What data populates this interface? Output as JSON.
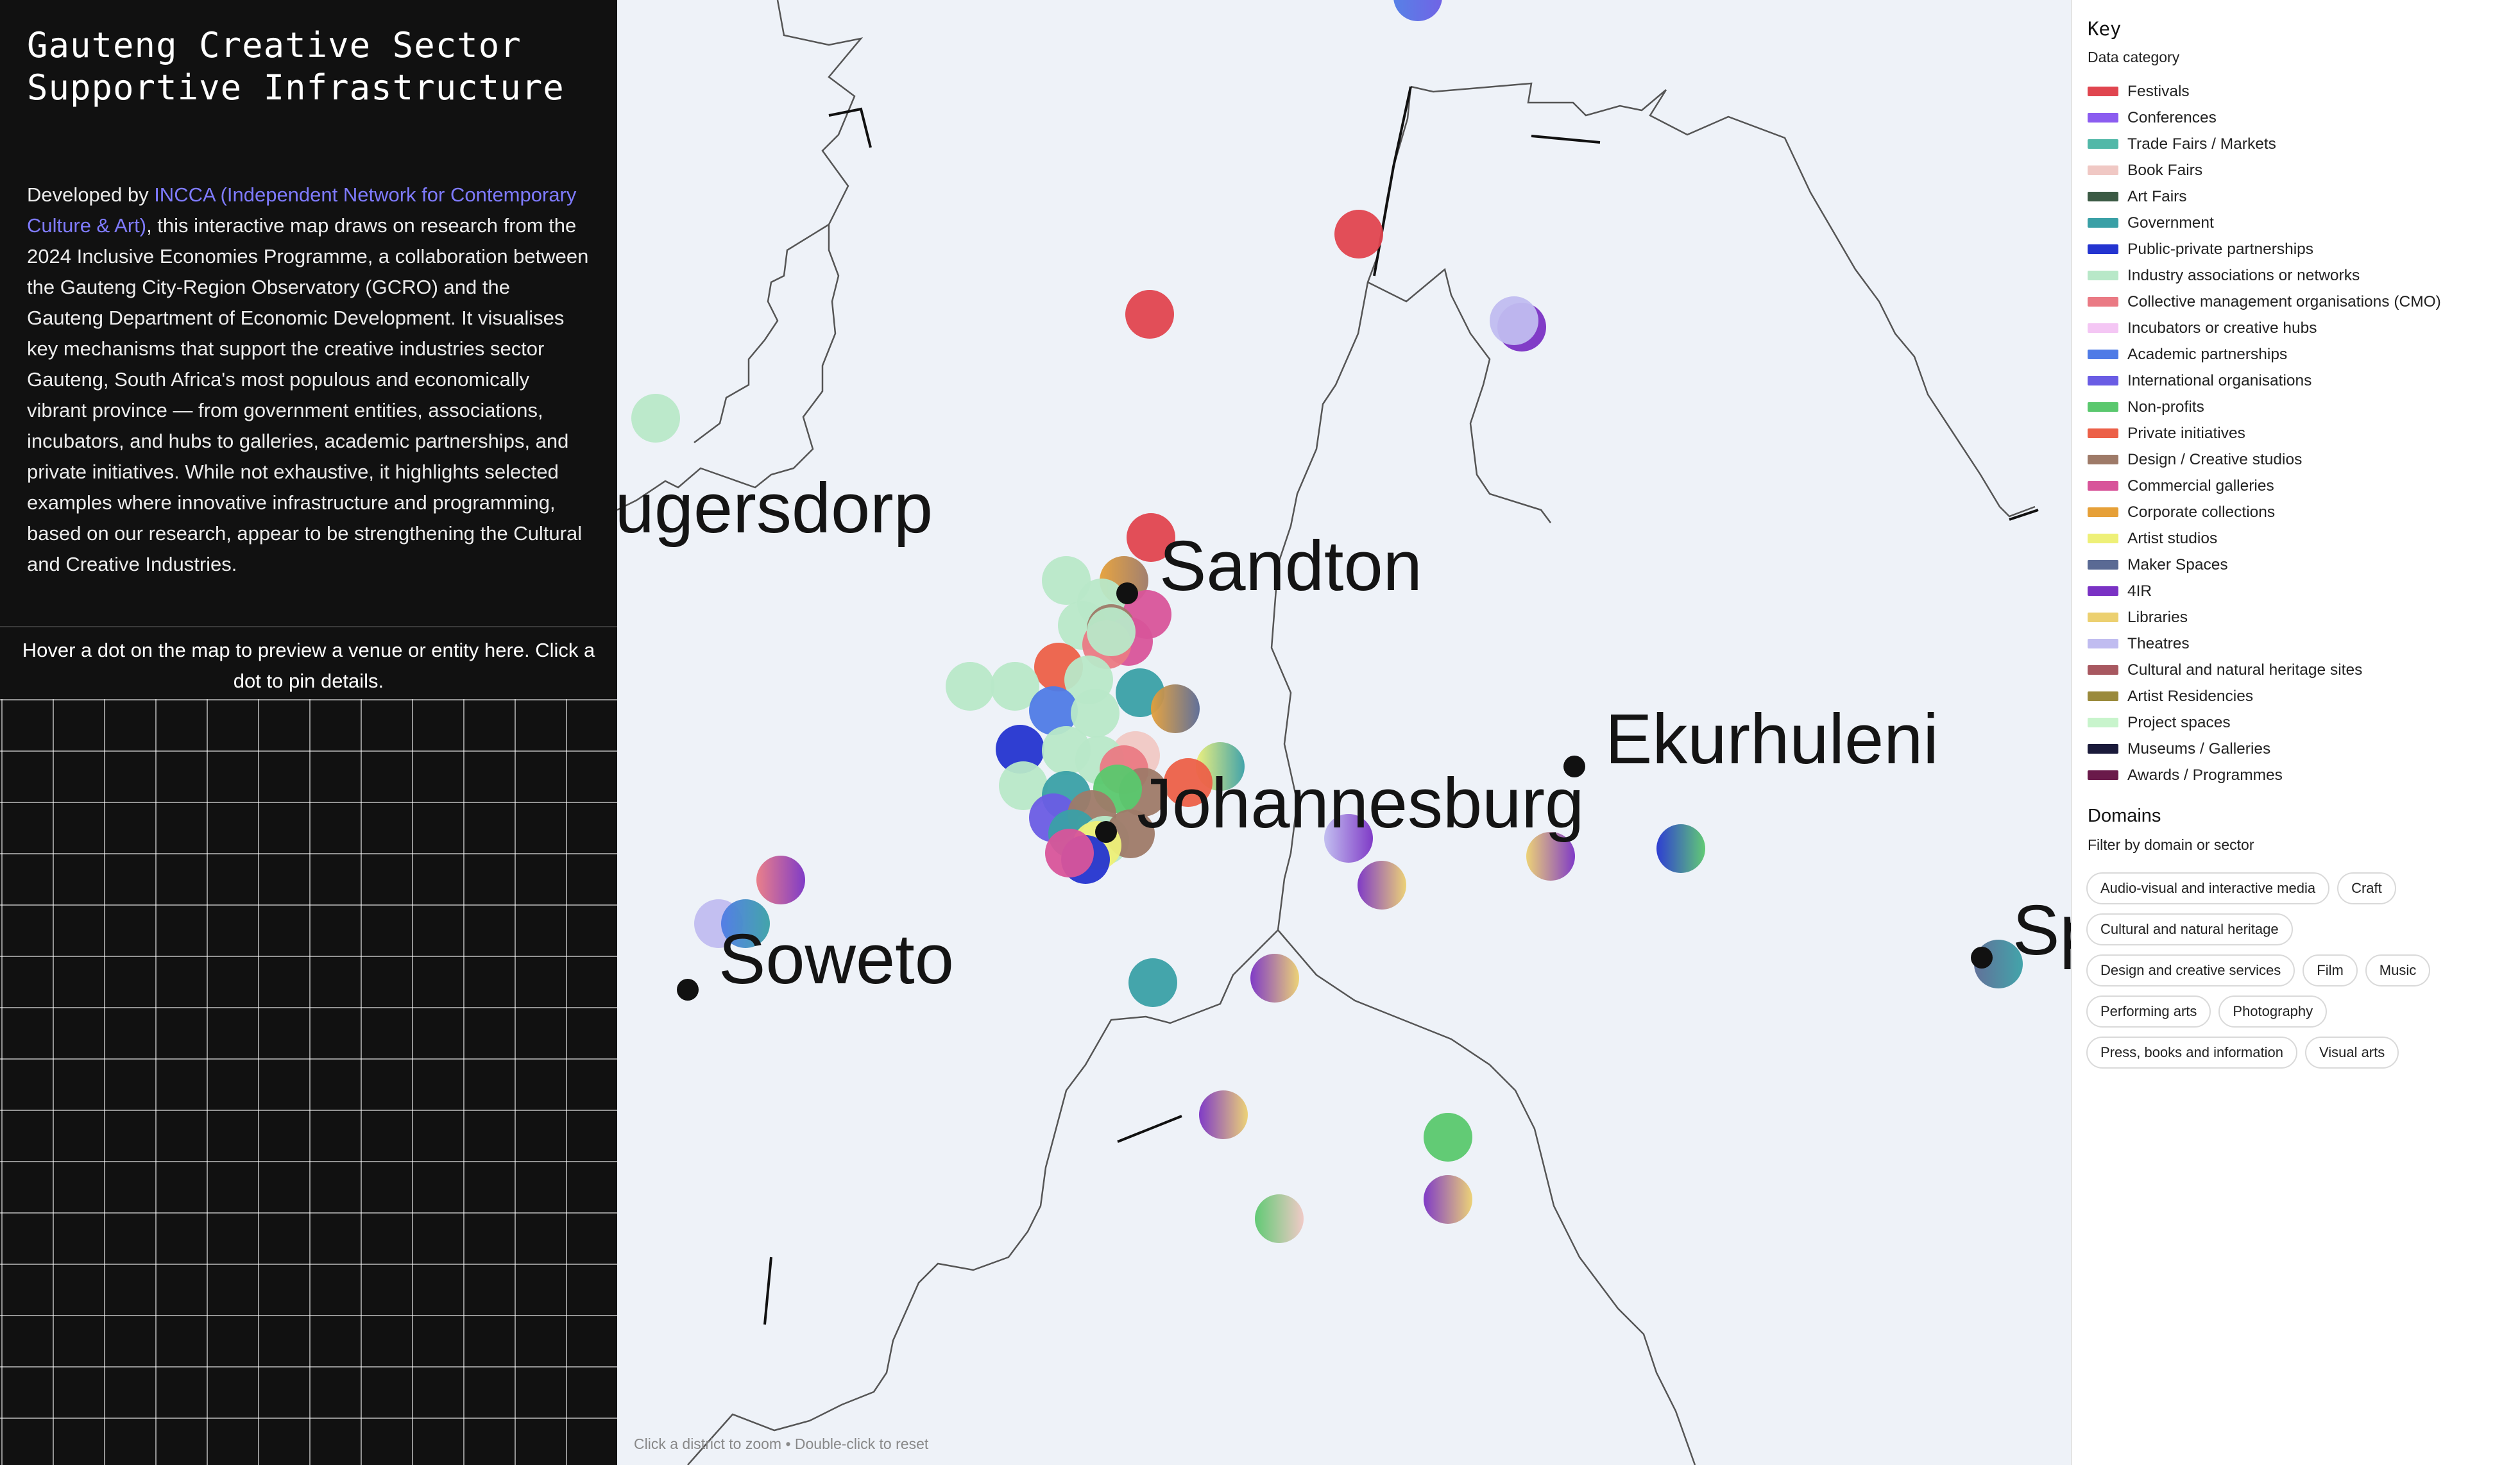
{
  "sidebar": {
    "title_line1": "Gauteng Creative Sector",
    "title_line2": "Supportive Infrastructure",
    "desc_prefix": "Developed by ",
    "link_text": "INCCA (Independent Network for Contemporary Culture & Art)",
    "desc_suffix": ", this interactive map draws on research from the 2024 Inclusive Economies Programme, a collaboration between the Gauteng City-Region Observatory (GCRO) and the Gauteng Department of Economic Development. It visualises key mechanisms that support the creative industries sector Gauteng, South Africa's most populous and economically vibrant province — from government entities, associations, incubators, and hubs to galleries, academic partnerships, and private initiatives. While not exhaustive, it highlights selected examples where innovative infrastructure and programming, based on our research, appear to be strengthening the Cultural and Creative Industries.",
    "hover_message": "Hover a dot on the map to preview a venue or entity here. Click a dot to pin details."
  },
  "map": {
    "hint": "Click a district to zoom • Double-click to reset",
    "cities": [
      "Krugersdorp",
      "Sandton",
      "Johannesburg",
      "Ekurhuleni",
      "Soweto",
      "Springs"
    ]
  },
  "key": {
    "title": "Key",
    "subtitle": "Data category",
    "items": [
      {
        "label": "Festivals",
        "color": "#e0454f"
      },
      {
        "label": "Conferences",
        "color": "#8b5cf0"
      },
      {
        "label": "Trade Fairs / Markets",
        "color": "#52b8a8"
      },
      {
        "label": "Book Fairs",
        "color": "#f0c8c4"
      },
      {
        "label": "Art Fairs",
        "color": "#3b5a44"
      },
      {
        "label": "Government",
        "color": "#3aa0a6"
      },
      {
        "label": "Public-private partnerships",
        "color": "#2434d0"
      },
      {
        "label": "Industry associations or networks",
        "color": "#b8e8c8"
      },
      {
        "label": "Collective management organisations (CMO)",
        "color": "#ea7a84"
      },
      {
        "label": "Incubators or creative hubs",
        "color": "#f4c6f4"
      },
      {
        "label": "Academic partnerships",
        "color": "#4f7be6"
      },
      {
        "label": "International organisations",
        "color": "#6a5ce4"
      },
      {
        "label": "Non-profits",
        "color": "#5ac86e"
      },
      {
        "label": "Private initiatives",
        "color": "#ec6048"
      },
      {
        "label": "Design / Creative studios",
        "color": "#9e7a68"
      },
      {
        "label": "Commercial galleries",
        "color": "#d8549a"
      },
      {
        "label": "Corporate collections",
        "color": "#e6a038"
      },
      {
        "label": "Artist studios",
        "color": "#eef078"
      },
      {
        "label": "Maker Spaces",
        "color": "#5a6a94"
      },
      {
        "label": "4IR",
        "color": "#7a32c4"
      },
      {
        "label": "Libraries",
        "color": "#ecd070"
      },
      {
        "label": "Theatres",
        "color": "#c0bcf0"
      },
      {
        "label": "Cultural and natural heritage sites",
        "color": "#a85860"
      },
      {
        "label": "Artist Residencies",
        "color": "#9a8a3c"
      },
      {
        "label": "Project spaces",
        "color": "#c8f4cc"
      },
      {
        "label": "Museums / Galleries",
        "color": "#1a1a3a"
      },
      {
        "label": "Awards / Programmes",
        "color": "#6a1a4a"
      }
    ]
  },
  "domains": {
    "title": "Domains",
    "subtitle": "Filter by domain or sector",
    "chips": [
      "Audio-visual and interactive media",
      "Craft",
      "Cultural and natural heritage",
      "Design and creative services",
      "Film",
      "Music",
      "Performing arts",
      "Photography",
      "Press, books and information",
      "Visual arts"
    ]
  }
}
